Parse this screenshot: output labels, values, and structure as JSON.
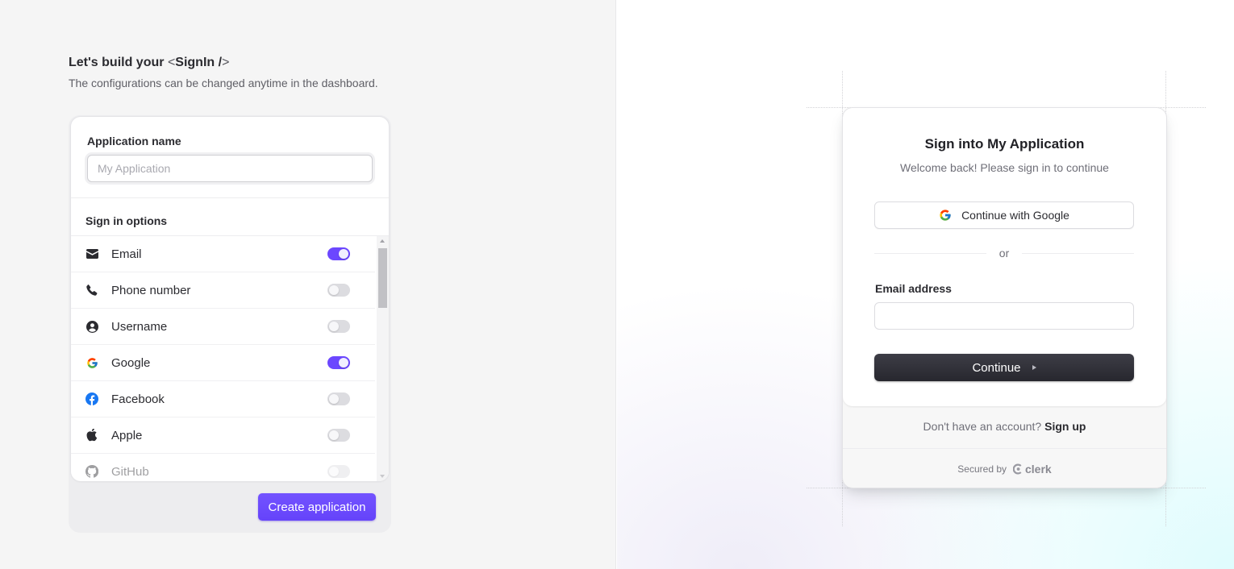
{
  "builder": {
    "heading_prefix": "Let's build your",
    "heading_code_open": "<",
    "heading_code_name": "SignIn /",
    "heading_code_close": ">",
    "subheading": "The configurations can be changed anytime in the dashboard.",
    "app_name": {
      "label": "Application name",
      "value": "",
      "placeholder": "My Application"
    },
    "sign_in_options": {
      "title": "Sign in options",
      "items": [
        {
          "label": "Email",
          "icon": "envelope-icon",
          "enabled": true
        },
        {
          "label": "Phone number",
          "icon": "phone-icon",
          "enabled": false
        },
        {
          "label": "Username",
          "icon": "user-circle-icon",
          "enabled": false
        },
        {
          "label": "Google",
          "icon": "google-icon",
          "enabled": true
        },
        {
          "label": "Facebook",
          "icon": "facebook-icon",
          "enabled": false
        },
        {
          "label": "Apple",
          "icon": "apple-icon",
          "enabled": false
        },
        {
          "label": "GitHub",
          "icon": "github-icon",
          "enabled": false
        }
      ]
    },
    "create_button": "Create application",
    "accent_color": "#6c47ff"
  },
  "preview": {
    "title": "Sign into My Application",
    "subtitle": "Welcome back! Please sign in to continue",
    "google_button": "Continue with Google",
    "divider_text": "or",
    "email_label": "Email address",
    "email_value": "",
    "continue_button": "Continue",
    "signup_prompt": "Don't have an account?",
    "signup_link": "Sign up",
    "secured_by": "Secured by",
    "brand": "clerk"
  }
}
